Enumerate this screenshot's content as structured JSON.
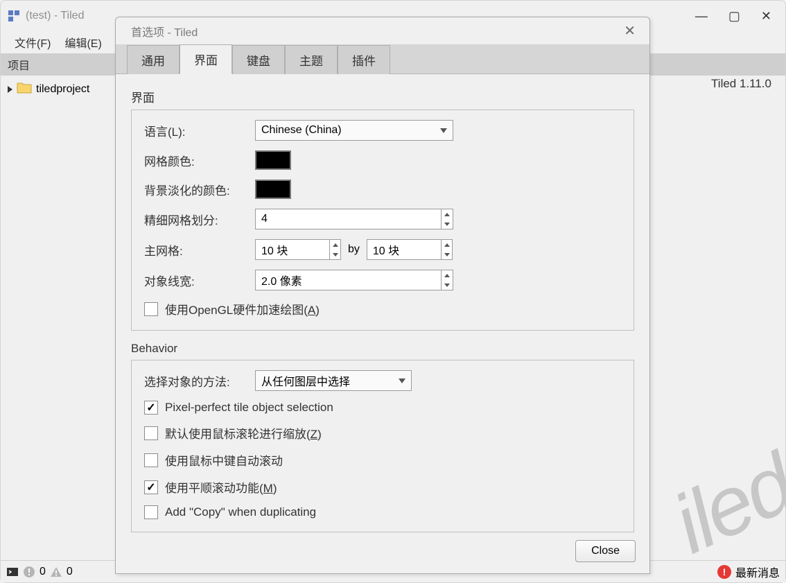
{
  "mainWindow": {
    "title": "(test) - Tiled",
    "menu": {
      "file": "文件(F)",
      "edit": "编辑(E)"
    },
    "project": {
      "header": "项目",
      "folderName": "tiledproject"
    },
    "version": "Tiled 1.11.0",
    "watermark": "iled"
  },
  "statusbar": {
    "errors": "0",
    "warnings": "0",
    "news": "最新消息"
  },
  "dialog": {
    "title": "首选项 - Tiled",
    "tabs": {
      "general": "通用",
      "interface": "界面",
      "keyboard": "键盘",
      "theme": "主题",
      "plugins": "插件"
    },
    "closeButton": "Close",
    "sections": {
      "interface": {
        "title": "界面",
        "language": {
          "label": "语言(L):",
          "value": "Chinese (China)"
        },
        "gridColor": {
          "label": "网格颜色:",
          "value": "#000000"
        },
        "fadeColor": {
          "label": "背景淡化的颜色:",
          "value": "#000000"
        },
        "fineGrid": {
          "label": "精细网格划分:",
          "value": "4"
        },
        "majorGrid": {
          "label": "主网格:",
          "value1": "10 块",
          "by": "by",
          "value2": "10 块"
        },
        "objectLineWidth": {
          "label": "对象线宽:",
          "value": "2.0 像素"
        },
        "opengl": {
          "labelPrefix": "使用OpenGL硬件加速绘图(",
          "hotkey": "A",
          "labelSuffix": ")",
          "checked": false
        }
      },
      "behavior": {
        "title": "Behavior",
        "selectMethod": {
          "label": "选择对象的方法:",
          "value": "从任何图层中选择"
        },
        "pixelPerfect": {
          "label": "Pixel-perfect tile object selection",
          "checked": true
        },
        "wheelZoom": {
          "labelPrefix": "默认使用鼠标滚轮进行缩放(",
          "hotkey": "Z",
          "labelSuffix": ")",
          "checked": false
        },
        "middleAutoscroll": {
          "label": "使用鼠标中键自动滚动",
          "checked": false
        },
        "smoothScroll": {
          "labelPrefix": "使用平顺滚动功能(",
          "hotkey": "M",
          "labelSuffix": ")",
          "checked": true
        },
        "addCopy": {
          "label": "Add \"Copy\" when duplicating",
          "checked": false
        }
      }
    }
  }
}
